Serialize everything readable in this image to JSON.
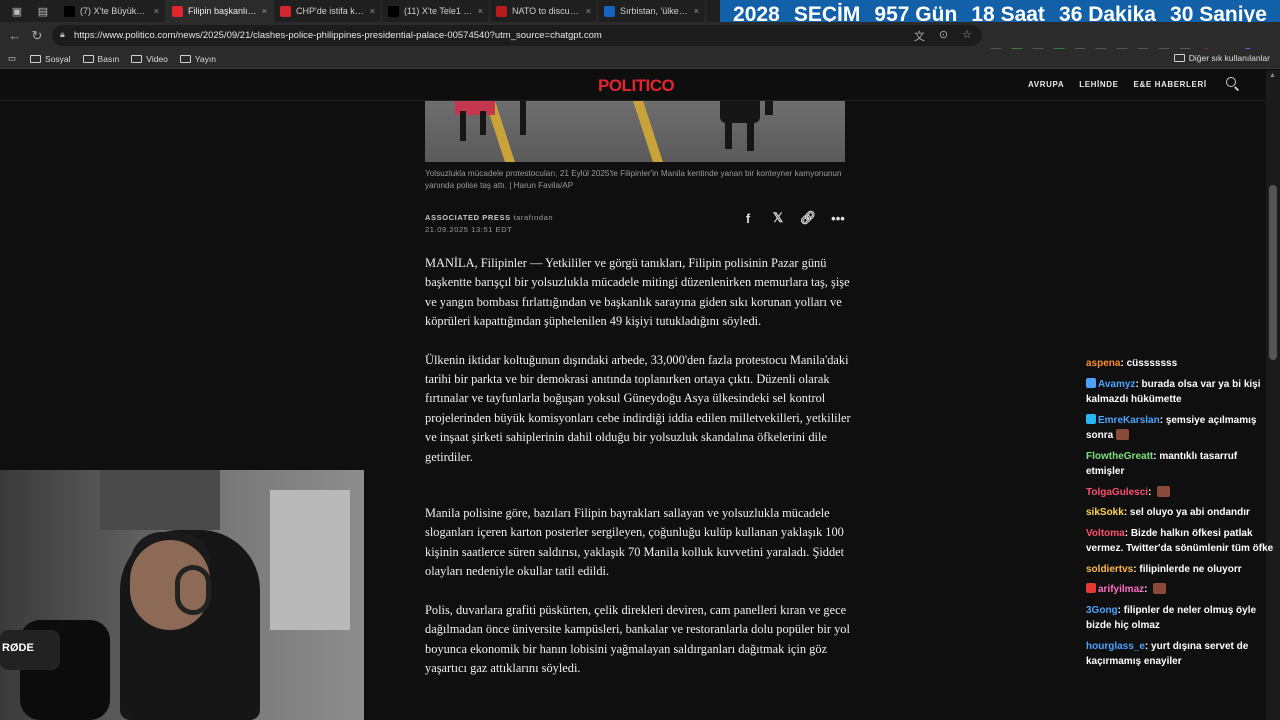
{
  "tabs": [
    {
      "title": "(7) X'te Büyükşehir",
      "favicon": "x-logo-icon",
      "color": "#000000",
      "active": false
    },
    {
      "title": "Filipin başkanlık sa",
      "favicon": "politico-icon",
      "color": "#e3252f",
      "active": true
    },
    {
      "title": "CHP'de istifa krizi:",
      "favicon": "tv-icon",
      "color": "#d4262f",
      "active": false
    },
    {
      "title": "(11) X'te Tele1 TV:",
      "favicon": "x-logo-icon",
      "color": "#000000",
      "active": false
    },
    {
      "title": "NATO to discuss R",
      "favicon": "globe-icon",
      "color": "#b71c1c",
      "active": false
    },
    {
      "title": "Sırbistan, 'ülkenin",
      "favicon": "news-icon",
      "color": "#1565c0",
      "active": false
    }
  ],
  "countdown": {
    "year": "2028",
    "label": "SEÇİM",
    "days": "957 Gün",
    "hours": "18 Saat",
    "minutes": "36 Dakika",
    "seconds": "30 Saniye",
    "bg": "#1160a8"
  },
  "address": {
    "url": "https://www.politico.com/news/2025/09/21/clashes-police-philippines-presidential-palace-00574540?utm_source=chatgpt.com"
  },
  "bookmarks": {
    "items": [
      "Sosyal",
      "Basın",
      "Video",
      "Yayın"
    ],
    "other": "Diğer sık kullanılanlar"
  },
  "site": {
    "logo": "POLITICO",
    "logo_color": "#e3252f",
    "nav": [
      "AVRUPA",
      "LEHİNDE",
      "E&E HABERLERİ"
    ]
  },
  "article": {
    "caption": "Yolsuzlukla mücadele protestocuları, 21 Eylül 2025'te Filipinler'in Manila kentinde yanan bir konteyner kamyonunun yanında polise taş attı. | Harun Favila/AP",
    "byline_author": "ASSOCIATED PRESS",
    "byline_suffix": "tarafından",
    "date": "21.09.2025 13:51 EDT",
    "paragraphs": [
      "MANİLA, Filipinler — Yetkililer ve görgü tanıkları, Filipin polisinin Pazar günü başkentte barışçıl bir yolsuzlukla mücadele mitingi düzenlenirken memurlara taş, şişe ve yangın bombası fırlattığından ve başkanlık sarayına giden sıkı korunan yolları ve köprüleri kapattığından şüphelenilen 49 kişiyi tutukladığını söyledi.",
      "Ülkenin iktidar koltuğunun dışındaki arbede, 33,000'den fazla protestocu Manila'daki tarihi bir parkta ve bir demokrasi anıtında toplanırken ortaya çıktı. Düzenli olarak fırtınalar ve tayfunlarla boğuşan yoksul Güneydoğu Asya ülkesindeki sel kontrol projelerinden büyük komisyonları cebe indirdiği iddia edilen milletvekilleri, yetkililer ve inşaat şirketi sahiplerinin dahil olduğu bir yolsuzluk skandalına öfkelerini dile getirdiler.",
      "Manila polisine göre, bazıları Filipin bayrakları sallayan ve yolsuzlukla mücadele sloganları içeren karton posterler sergileyen, çoğunluğu kulüp kullanan yaklaşık 100 kişinin saatlerce süren saldırısı, yaklaşık 70 Manila kolluk kuvvetini yaraladı. Şiddet olayları nedeniyle okullar tatil edildi.",
      "Polis, duvarlara grafiti püskürten, çelik direkleri deviren, cam panelleri kıran ve gece dağılmadan önce üniversite kampüsleri, bankalar ve restoranlarla dolu popüler bir yol boyunca ekonomik bir hanın lobisini yağmalayan saldırganları dağıtmak için göz yaşartıcı gaz attıklarını söyledi."
    ]
  },
  "chat": {
    "messages": [
      {
        "user": "aspena",
        "color": "#ff8c2a",
        "text": "cüsssssss",
        "badge": "",
        "emote": false
      },
      {
        "user": "Avamyz",
        "color": "#4aa3ff",
        "text": "burada olsa var ya bi kişi kalmazdı hükümette",
        "badge": "#4aa3ff",
        "emote": false
      },
      {
        "user": "EmreKarslan",
        "color": "#4aa3ff",
        "text": "şemsiye açılmamış sonra",
        "badge": "#29b6f6",
        "emote": true
      },
      {
        "user": "FlowtheGreatt",
        "color": "#7ee07e",
        "text": "mantıklı tasarruf etmişler",
        "badge": "",
        "emote": false
      },
      {
        "user": "TolgaGulesci",
        "color": "#ff4d6d",
        "text": "",
        "badge": "",
        "emote": true
      },
      {
        "user": "sikSokk",
        "color": "#ffd54f",
        "text": "sel oluyo ya abi ondandır",
        "badge": "",
        "emote": false
      },
      {
        "user": "Voltoma",
        "color": "#ff4d6d",
        "text": "Bizde halkın öfkesi patlak vermez. Twitter'da sönümlenir tüm öfke",
        "badge": "",
        "emote": false
      },
      {
        "user": "soldiertvs",
        "color": "#ffb74d",
        "text": "filipinlerde ne oluyorr",
        "badge": "",
        "emote": false
      },
      {
        "user": "arifyilmaz",
        "color": "#ff6ec7",
        "text": "",
        "badge": "#e53935",
        "emote": true
      },
      {
        "user": "3Gong",
        "color": "#4aa3ff",
        "text": "filipnler de neler olmuş öyle bizde hiç olmaz",
        "badge": "",
        "emote": false
      },
      {
        "user": "hourglass_e",
        "color": "#4aa3ff",
        "text": "yurt dışına servet de kaçırmamış enayiler",
        "badge": "",
        "emote": false
      }
    ]
  },
  "webcam": {
    "mic_label": "RØDE"
  }
}
